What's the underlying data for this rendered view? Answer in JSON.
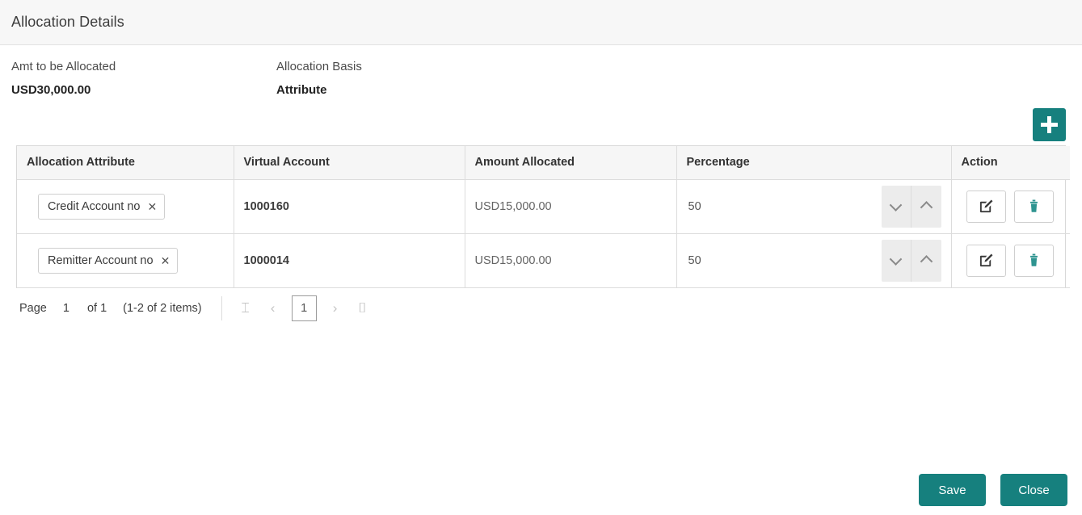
{
  "header": {
    "title": "Allocation Details"
  },
  "summary": {
    "fields": [
      {
        "label": "Amt to be Allocated",
        "value": "USD30,000.00",
        "weight": "bold"
      },
      {
        "label": "Allocation Basis",
        "value": "Attribute",
        "weight": "medium"
      }
    ]
  },
  "toolbar": {
    "add_icon": "plus-icon",
    "add_label": "Add"
  },
  "table": {
    "columns": [
      "Allocation Attribute",
      "Virtual Account",
      "Amount Allocated",
      "Percentage",
      "Action"
    ],
    "rows": [
      {
        "attribute": "Credit Account no",
        "chip_remove_icon": "✕",
        "virtual_account": "1000160",
        "amount_allocated": "USD15,000.00",
        "percentage": "50",
        "edit_icon": "edit-icon",
        "delete_icon": "delete-icon"
      },
      {
        "attribute": "Remitter Account no",
        "chip_remove_icon": "✕",
        "virtual_account": "1000014",
        "amount_allocated": "USD15,000.00",
        "percentage": "50",
        "edit_icon": "edit-icon",
        "delete_icon": "delete-icon"
      }
    ]
  },
  "pagination": {
    "page_label": "Page",
    "page_number": "1",
    "of_label": "of 1",
    "items_label": "(1-2 of 2 items)",
    "first_icon": "⌶",
    "prev_icon": "‹",
    "current_page": "1",
    "next_icon": "›",
    "last_icon": "⌷"
  },
  "footer": {
    "save_label": "Save",
    "close_label": "Close"
  },
  "colors": {
    "accent_teal": "#16807e",
    "header_bg": "#f7f7f7",
    "table_header_bg": "#f6f6f6",
    "border": "#dcdcdc",
    "delete_icon": "#2e9490"
  }
}
